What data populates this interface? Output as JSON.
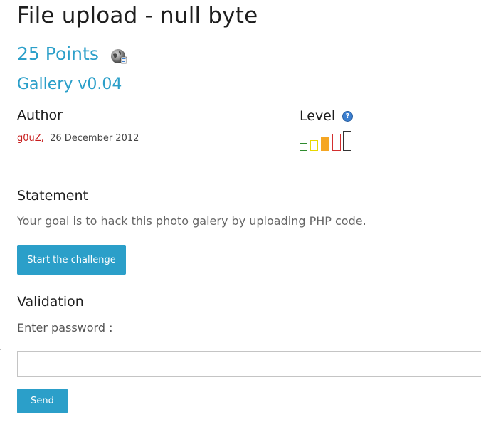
{
  "challenge": {
    "title": "File upload - null byte",
    "points": "25 Points",
    "subtitle": "Gallery v0.04"
  },
  "author": {
    "heading": "Author",
    "name": "g0uZ",
    "separator": ",",
    "date": "26 December 2012"
  },
  "level": {
    "heading": "Level",
    "help_icon": "?",
    "current": 3,
    "max": 5
  },
  "statement": {
    "heading": "Statement",
    "text": "Your goal is to hack this photo galery by uploading PHP code.",
    "start_button": "Start the challenge"
  },
  "validation": {
    "heading": "Validation",
    "label": "Enter password :",
    "input_value": "",
    "send_button": "Send"
  },
  "icons": {
    "points": "globe-icon",
    "help": "help-icon"
  },
  "colors": {
    "accent": "#2b9fc9",
    "author_name": "#c81e1e",
    "level_bars": [
      "#2e8b2e",
      "#e8d800",
      "#f5a623",
      "#d32f2f",
      "#333333"
    ]
  }
}
